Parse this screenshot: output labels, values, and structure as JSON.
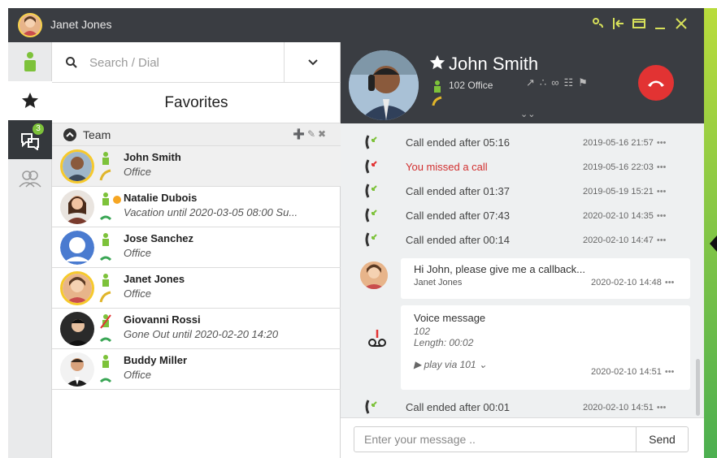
{
  "window": {
    "title": "Janet Jones"
  },
  "colors": {
    "accent_green": "#7dc23a",
    "accent_yellow": "#f6c92c",
    "header_dark": "#3a3d42",
    "missed_red": "#d23030",
    "hangup_red": "#e23333"
  },
  "rail": {
    "chat_badge": "3"
  },
  "search": {
    "placeholder": "Search / Dial"
  },
  "favorites": {
    "title": "Favorites"
  },
  "group": {
    "name": "Team"
  },
  "contacts": [
    {
      "name": "John Smith",
      "sub": "Office"
    },
    {
      "name": "Natalie Dubois",
      "sub": "Vacation until 2020-03-05 08:00 Su..."
    },
    {
      "name": "Jose Sanchez",
      "sub": "Office"
    },
    {
      "name": "Janet Jones",
      "sub": "Office"
    },
    {
      "name": "Giovanni Rossi",
      "sub": "Gone Out until 2020-02-20 14:20"
    },
    {
      "name": "Buddy Miller",
      "sub": "Office"
    }
  ],
  "chat": {
    "name": "John Smith",
    "sub": "102 Office",
    "history": [
      {
        "text": "Call ended after 05:16",
        "time": "2019-05-16 21:57"
      },
      {
        "text": "You missed a call",
        "time": "2019-05-16 22:03"
      },
      {
        "text": "Call ended after 01:37",
        "time": "2019-05-19 15:21"
      },
      {
        "text": "Call ended after 07:43",
        "time": "2020-02-10 14:35"
      },
      {
        "text": "Call ended after 00:14",
        "time": "2020-02-10 14:47"
      }
    ],
    "message": {
      "text": "Hi John, please give me a callback...",
      "author": "Janet Jones",
      "time": "2020-02-10 14:48"
    },
    "voicemail": {
      "title": "Voice message",
      "number": "102",
      "length": "Length: 00:02",
      "play": "play via 101",
      "time": "2020-02-10 14:51"
    },
    "last_call": {
      "text": "Call ended after 00:01",
      "time": "2020-02-10 14:51"
    },
    "more": "•••"
  },
  "composer": {
    "placeholder": "Enter your message ..",
    "send": "Send"
  }
}
